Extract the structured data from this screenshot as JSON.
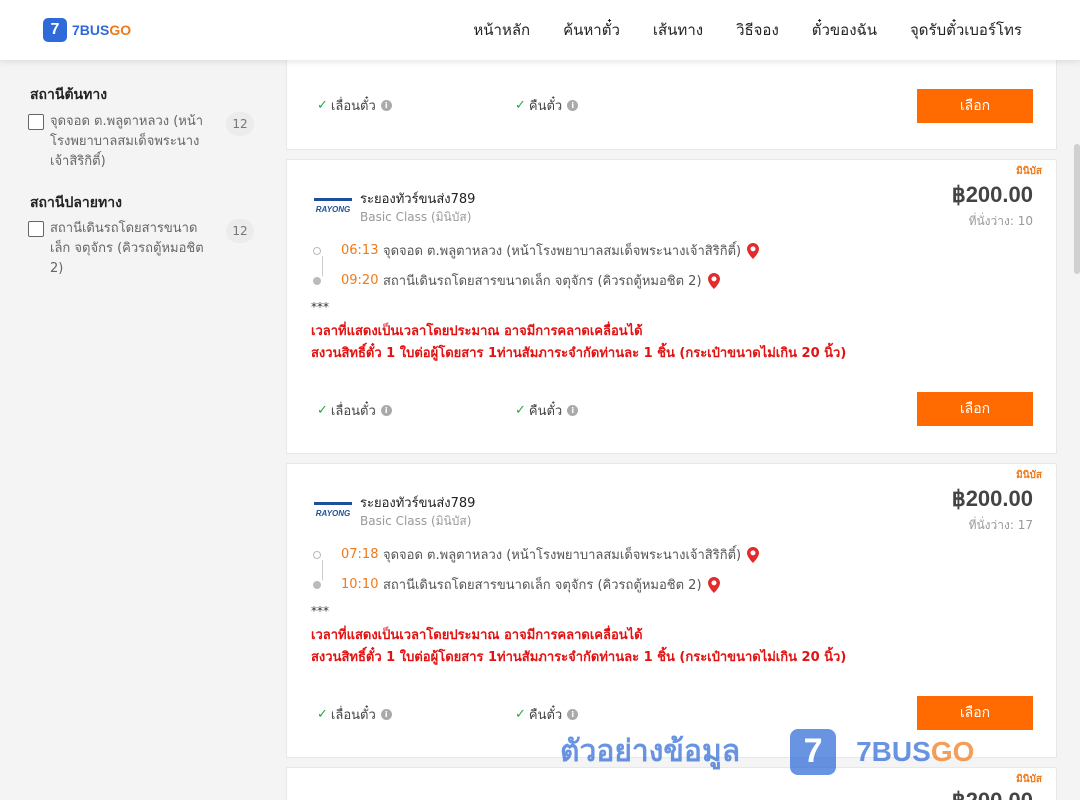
{
  "brand": {
    "logo_digit": "7",
    "name_prefix": "7BUS",
    "name_suffix": "GO"
  },
  "nav": {
    "items": [
      {
        "label": "หน้าหลัก"
      },
      {
        "label": "ค้นหาตั๋ว"
      },
      {
        "label": "เส้นทาง"
      },
      {
        "label": "วิธีจอง"
      },
      {
        "label": "ตั๋วของฉัน"
      },
      {
        "label": "จุดรับตั๋วเบอร์โทร"
      }
    ]
  },
  "sidebar": {
    "origin_title": "สถานีต้นทาง",
    "origin_option": {
      "label": "จุดจอด ต.พลูตาหลวง (หน้าโรงพยาบาลสมเด็จพระนางเจ้าสิริกิติ์)",
      "count": "12"
    },
    "destination_title": "สถานีปลายทาง",
    "destination_option": {
      "label": "สถานีเดินรถโดยสารขนาดเล็ก จตุจักร (คิวรถตู้หมอชิต 2)",
      "count": "12"
    }
  },
  "common": {
    "reschedule": "เลื่อนตั๋ว",
    "refund": "คืนตั๋ว",
    "select_button": "เลือก",
    "info_icon": "i",
    "check_icon": "✓"
  },
  "cards": [
    {
      "tag": "มินิบัส",
      "operator": "ระยองทัวร์ขนส่ง789",
      "operator_logo_text": "RAYONG",
      "class": "Basic Class (มินิบัส)",
      "price": "฿200.00",
      "seats": "ที่นั่งว่าง: 10",
      "depart_time": "06:13",
      "depart_station": "จุดจอด ต.พลูตาหลวง (หน้าโรงพยาบาลสมเด็จพระนางเจ้าสิริกิติ์)",
      "arrive_time": "09:20",
      "arrive_station": "สถานีเดินรถโดยสารขนาดเล็ก จตุจักร (คิวรถตู้หมอชิต 2)",
      "note_stars": "***",
      "note_line1": "เวลาที่แสดงเป็นเวลาโดยประมาณ อาจมีการคลาดเคลื่อนได้",
      "note_line2": "สงวนสิทธิ์ตั๋ว 1 ใบต่อผู้โดยสาร 1ท่านสัมภาระจำกัดท่านละ 1 ชิ้น (กระเป๋าขนาดไม่เกิน 20 นิ้ว)"
    },
    {
      "tag": "มินิบัส",
      "operator": "ระยองทัวร์ขนส่ง789",
      "operator_logo_text": "RAYONG",
      "class": "Basic Class (มินิบัส)",
      "price": "฿200.00",
      "seats": "ที่นั่งว่าง: 17",
      "depart_time": "07:18",
      "depart_station": "จุดจอด ต.พลูตาหลวง (หน้าโรงพยาบาลสมเด็จพระนางเจ้าสิริกิติ์)",
      "arrive_time": "10:10",
      "arrive_station": "สถานีเดินรถโดยสารขนาดเล็ก จตุจักร (คิวรถตู้หมอชิต 2)",
      "note_stars": "***",
      "note_line1": "เวลาที่แสดงเป็นเวลาโดยประมาณ อาจมีการคลาดเคลื่อนได้",
      "note_line2": "สงวนสิทธิ์ตั๋ว 1 ใบต่อผู้โดยสาร 1ท่านสัมภาระจำกัดท่านละ 1 ชิ้น (กระเป๋าขนาดไม่เกิน 20 นิ้ว)"
    },
    {
      "tag": "มินิบัส",
      "price": "฿200.00"
    }
  ],
  "watermark": {
    "text": "ตัวอย่างข้อมูล",
    "digit": "7",
    "brand_prefix": "7BUS",
    "brand_suffix": "GO"
  },
  "colors": {
    "accent": "#ff6b00",
    "brand_blue": "#2f6bd8",
    "warning_red": "#e31212",
    "time_orange": "#f07a1a"
  }
}
